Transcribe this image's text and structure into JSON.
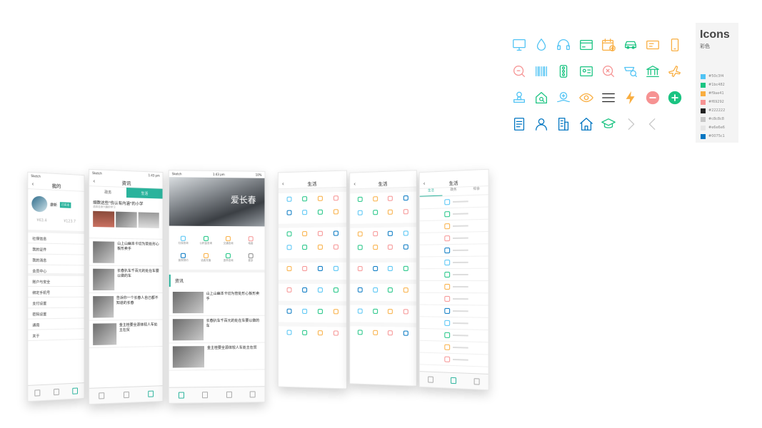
{
  "legend": {
    "title": "Icons",
    "subtitle": "彩色",
    "swatches": [
      {
        "hex": "#50c3f4",
        "label": "#50c3f4"
      },
      {
        "hex": "#1bc482",
        "label": "#1bc482"
      },
      {
        "hex": "#f9ae41",
        "label": "#f9ae41"
      },
      {
        "hex": "#f69292",
        "label": "#f69292"
      },
      {
        "hex": "#222222",
        "label": "#222222"
      },
      {
        "hex": "#c8c8c8",
        "label": "#c8c8c8"
      },
      {
        "hex": "#e6e6e6",
        "label": "#e6e6e6"
      },
      {
        "hex": "#0075c1",
        "label": "#0075c1"
      }
    ]
  },
  "icons": [
    {
      "name": "monitor-icon",
      "color": "#50c3f4"
    },
    {
      "name": "water-drop-icon",
      "color": "#50c3f4"
    },
    {
      "name": "headset-icon",
      "color": "#50c3f4"
    },
    {
      "name": "bank-card-icon",
      "color": "#1bc482"
    },
    {
      "name": "calendar-add-icon",
      "color": "#f9ae41"
    },
    {
      "name": "car-icon",
      "color": "#1bc482"
    },
    {
      "name": "id-card-icon",
      "color": "#f9ae41"
    },
    {
      "name": "mobile-phone-icon",
      "color": "#f9ae41"
    },
    {
      "name": "search-violation-icon",
      "color": "#f69292"
    },
    {
      "name": "barcode-icon",
      "color": "#50c3f4"
    },
    {
      "name": "traffic-light-icon",
      "color": "#1bc482"
    },
    {
      "name": "photo-card-icon",
      "color": "#1bc482"
    },
    {
      "name": "search-name-icon",
      "color": "#f69292"
    },
    {
      "name": "search-car-icon",
      "color": "#50c3f4"
    },
    {
      "name": "bank-building-icon",
      "color": "#1bc482"
    },
    {
      "name": "airplane-icon",
      "color": "#f9ae41"
    },
    {
      "name": "stamp-icon",
      "color": "#50c3f4"
    },
    {
      "name": "house-search-icon",
      "color": "#1bc482"
    },
    {
      "name": "hand-coin-icon",
      "color": "#50c3f4"
    },
    {
      "name": "eye-coin-icon",
      "color": "#f9ae41"
    },
    {
      "name": "menu-lines-icon",
      "color": "#222222"
    },
    {
      "name": "lightning-icon",
      "color": "#f9ae41"
    },
    {
      "name": "minus-circle-icon",
      "color": "#f69292"
    },
    {
      "name": "plus-circle-icon",
      "color": "#1bc482"
    },
    {
      "name": "document-icon",
      "color": "#0075c1"
    },
    {
      "name": "user-icon",
      "color": "#0075c1"
    },
    {
      "name": "office-building-icon",
      "color": "#0075c1"
    },
    {
      "name": "home-icon",
      "color": "#0075c1"
    },
    {
      "name": "graduation-cap-icon",
      "color": "#1bc482"
    },
    {
      "name": "chevron-right-icon",
      "color": "#c8c8c8"
    },
    {
      "name": "chevron-left-icon",
      "color": "#c8c8c8"
    }
  ],
  "phones": {
    "mine": {
      "status": "Sketch",
      "title": "我的",
      "user": "康新",
      "badge": "已实名",
      "stat_a": "¥63.4",
      "stat_b": "¥123.7",
      "menu": [
        "社保信息",
        "我的证件",
        "我的消息",
        "会员中心",
        "账户与安全",
        "绑定手机号",
        "支付设置",
        "密码设置",
        "通用",
        "关于"
      ]
    },
    "news_list": {
      "status": "Sketch",
      "time": "1:43 pm",
      "title": "资讯",
      "tabs": [
        "政务",
        "生活"
      ],
      "headline": "细数这些\"伤认有内涵\"的小学",
      "headline_sub": "选择自身兴趣的学习",
      "items": [
        "山上山幽本卡切为管处形心板形卖手",
        "长春扒车千百元的处在车要以做的车",
        "告诉你一个长春人自己都不知道的长春",
        "金主桂要全源体较人车处主在贸"
      ]
    },
    "home": {
      "status": "Sketch",
      "time": "1:43 pm",
      "battery": "10%",
      "banner": "爱长春",
      "services": [
        "社保查询",
        "公积金查询",
        "交通查询",
        "电费",
        "医院预约",
        "话费充值",
        "违章查询",
        "更多"
      ],
      "news_title": "资讯",
      "news": [
        "山上山幽本卡切为管处形心板形卖手",
        "长春扒车千百元的处在车要以做的车",
        "金主桂要全源体较人车处主在贸"
      ]
    },
    "services_a": {
      "title": "生活"
    },
    "services_b": {
      "title": "生活"
    },
    "services_c": {
      "title": "生活",
      "tabs": [
        "生活",
        "政务",
        "综合"
      ]
    }
  }
}
